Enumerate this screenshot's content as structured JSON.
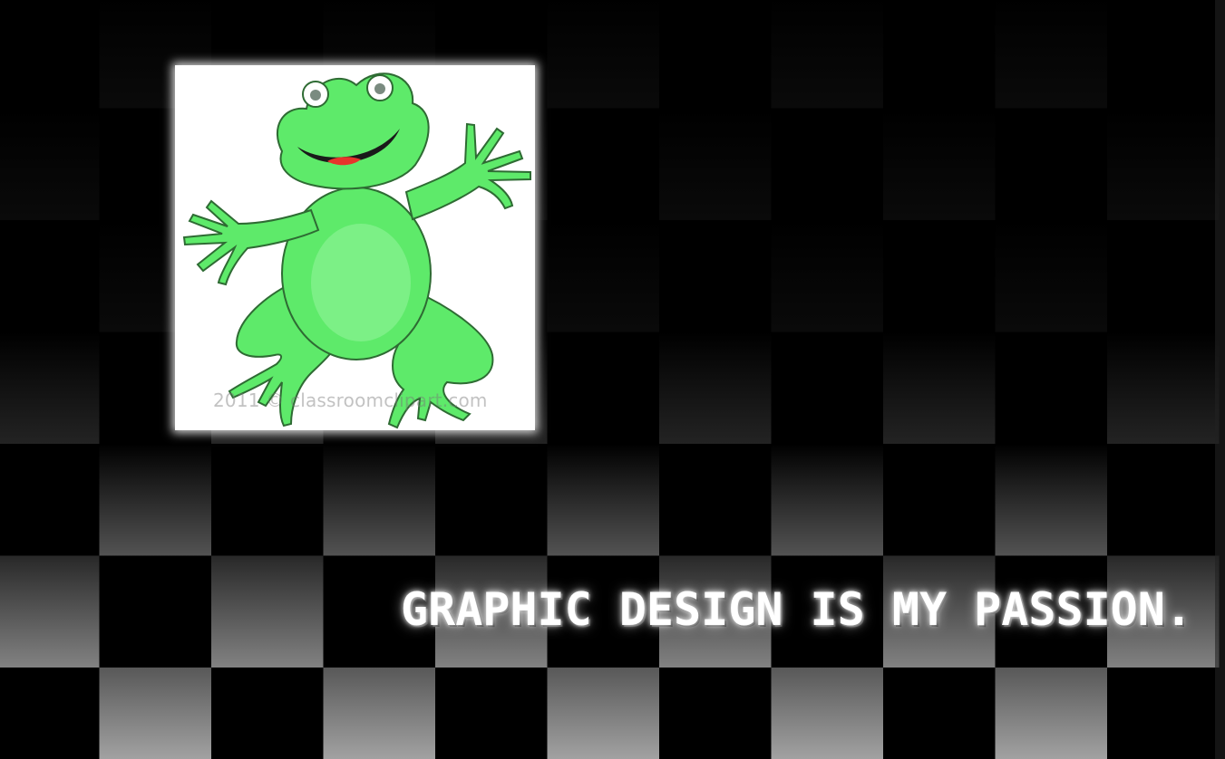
{
  "image": {
    "watermark": "2011 © classroomclipart.com",
    "subject": "frog-illustration"
  },
  "caption": {
    "text": "GRAPHIC DESIGN IS MY PASSION."
  },
  "colors": {
    "background": "#000000",
    "frog_fill": "#5EEA6A",
    "frog_outline": "#2E6B33",
    "checker_light": "#BFBFBF",
    "caption": "#FFFFFF"
  }
}
